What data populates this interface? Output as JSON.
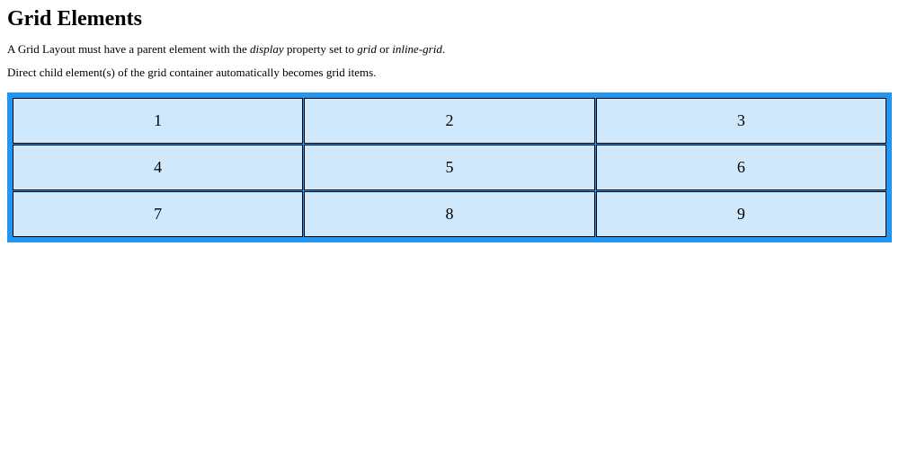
{
  "heading": "Grid Elements",
  "paragraph1_part1": "A Grid Layout must have a parent element with the ",
  "paragraph1_em1": "display",
  "paragraph1_part2": " property set to ",
  "paragraph1_em2": "grid",
  "paragraph1_part3": " or ",
  "paragraph1_em3": "inline-grid",
  "paragraph1_part4": ".",
  "paragraph2": "Direct child element(s) of the grid container automatically becomes grid items.",
  "grid": {
    "items": [
      "1",
      "2",
      "3",
      "4",
      "5",
      "6",
      "7",
      "8",
      "9"
    ]
  }
}
